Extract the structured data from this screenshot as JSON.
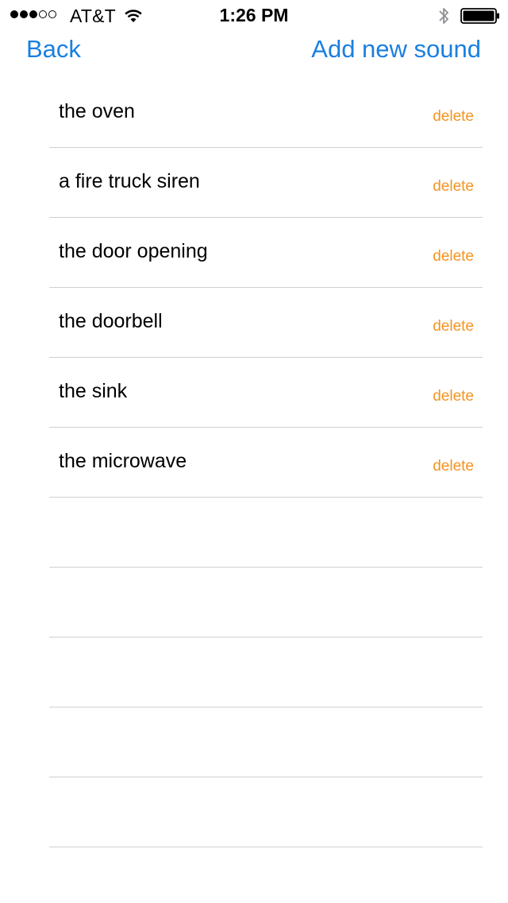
{
  "status_bar": {
    "signal_bars_filled": 3,
    "signal_bars_total": 5,
    "carrier": "AT&T",
    "time": "1:26 PM",
    "icons": [
      "wifi-icon",
      "bluetooth-icon",
      "battery-icon"
    ]
  },
  "nav": {
    "back_label": "Back",
    "add_label": "Add new sound"
  },
  "colors": {
    "link_blue": "#1a7fe0",
    "delete_orange": "#f39422",
    "separator": "#cfcfd2"
  },
  "sounds": [
    {
      "name": "the oven",
      "delete_label": "delete"
    },
    {
      "name": "a fire truck siren",
      "delete_label": "delete"
    },
    {
      "name": "the door opening",
      "delete_label": "delete"
    },
    {
      "name": "the doorbell",
      "delete_label": "delete"
    },
    {
      "name": "the sink",
      "delete_label": "delete"
    },
    {
      "name": "the microwave",
      "delete_label": "delete"
    }
  ]
}
